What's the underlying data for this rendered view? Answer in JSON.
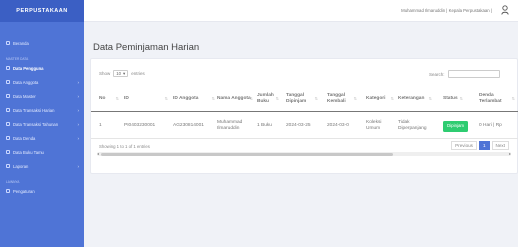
{
  "app": {
    "brand": "PERPUSTAKAAN"
  },
  "sidebar": {
    "items": [
      {
        "label": "Beranda",
        "type": "item"
      },
      {
        "label": "MASTER DATA",
        "type": "heading"
      },
      {
        "label": "Data Pengguna",
        "type": "item",
        "active": true
      },
      {
        "label": "Data Anggota",
        "type": "item",
        "chevron": true
      },
      {
        "label": "Data Master",
        "type": "item",
        "chevron": true
      },
      {
        "label": "Data Transaksi Harian",
        "type": "item",
        "chevron": true
      },
      {
        "label": "Data Transaksi Tahunan",
        "type": "item",
        "chevron": true
      },
      {
        "label": "Data Denda",
        "type": "item",
        "chevron": true
      },
      {
        "label": "Data Buku Tamu",
        "type": "item"
      },
      {
        "label": "Laporan",
        "type": "item",
        "chevron": true
      },
      {
        "label": "LAINNYA",
        "type": "heading"
      },
      {
        "label": "Pengaturan",
        "type": "item"
      }
    ]
  },
  "topbar": {
    "user": "Muhammad Ilmaruddin | Kepala Perpustakaan |"
  },
  "page": {
    "title": "Data Peminjaman Harian"
  },
  "table_controls": {
    "show_label": "Show",
    "entries_value": "10",
    "entries_label": "entries",
    "search_label": "Search:",
    "info": "Showing 1 to 1 of 1 entries",
    "prev": "Previous",
    "page": "1",
    "next": "Next"
  },
  "table": {
    "headers": [
      "No",
      "ID",
      "ID Anggota",
      "Nama Anggota",
      "Jumlah Buku",
      "Tanggal Dipinjam",
      "Tanggal Kembali",
      "Kategori",
      "Keterangan",
      "Status",
      "Denda Terlambat"
    ],
    "rows": [
      [
        "1",
        "PI0403230001",
        "AG230814001",
        "Muhammad Ilmaruddin",
        "1 Buku",
        "2024-03-25",
        "2024-03-0",
        "Koleksi Umum",
        "Tidak Diperpanjang",
        "Dipinjam",
        "0 Hari | Rp"
      ]
    ]
  },
  "colors": {
    "sidebar": "#4f74d6",
    "status_badge": "#2ecc71"
  }
}
